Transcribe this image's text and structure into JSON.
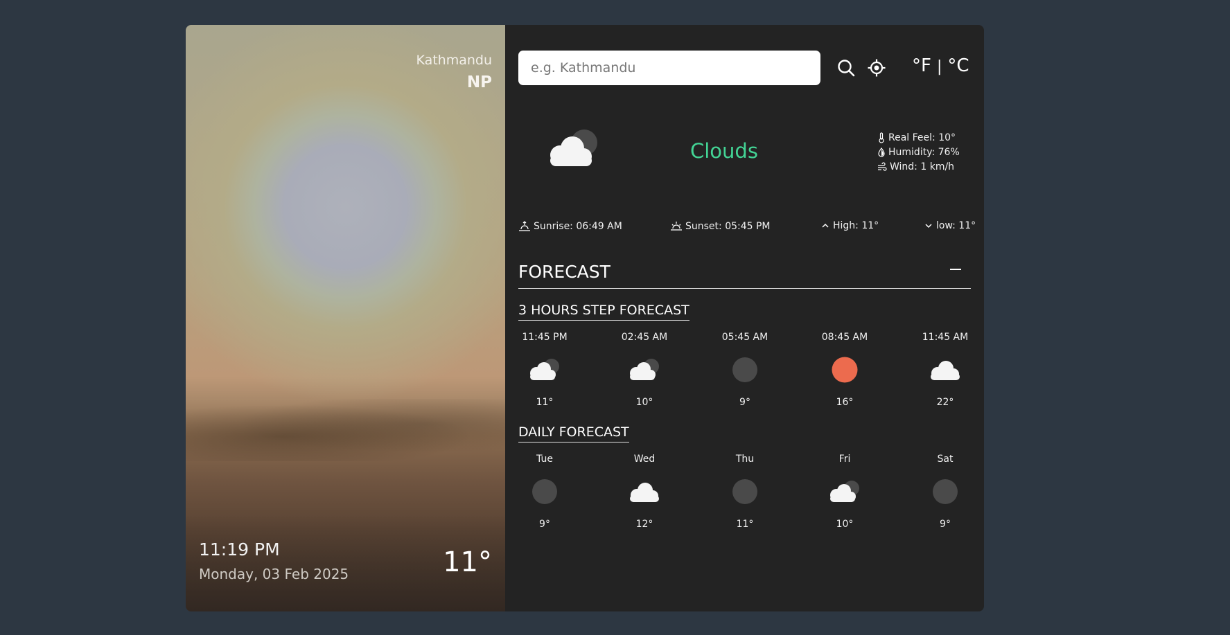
{
  "location": {
    "city": "Kathmandu",
    "country": "NP"
  },
  "left": {
    "time": "11:19 PM",
    "date": "Monday, 03 Feb 2025",
    "temperature": "11°"
  },
  "search": {
    "placeholder": "e.g. Kathmandu",
    "value": ""
  },
  "units": {
    "f": "°F",
    "separator": "|",
    "c": "°C"
  },
  "current": {
    "icon": "cloud-icon",
    "condition": "Clouds",
    "condition_color": "#43d495",
    "real_feel": "Real Feel:  10°",
    "humidity": "Humidity:  76%",
    "wind": "Wind:  1 km/h"
  },
  "sun": {
    "sunrise": "Sunrise: 06:49 AM",
    "sunset": "Sunset: 05:45 PM",
    "high": "High: 11°",
    "low": "low: 11°"
  },
  "forecast": {
    "title": "FORECAST",
    "hourly_title": "3 HOURS STEP FORECAST",
    "hourly": [
      {
        "label": "11:45 PM",
        "icon": "cloud-moon-icon",
        "temp": "11°"
      },
      {
        "label": "02:45 AM",
        "icon": "cloud-moon-icon",
        "temp": "10°"
      },
      {
        "label": "05:45 AM",
        "icon": "moon-icon",
        "temp": "9°"
      },
      {
        "label": "08:45 AM",
        "icon": "sun-icon",
        "temp": "16°"
      },
      {
        "label": "11:45 AM",
        "icon": "cloud-icon",
        "temp": "22°"
      }
    ],
    "daily_title": "DAILY FORECAST",
    "daily": [
      {
        "label": "Tue",
        "icon": "moon-icon",
        "temp": "9°"
      },
      {
        "label": "Wed",
        "icon": "cloud-icon",
        "temp": "12°"
      },
      {
        "label": "Thu",
        "icon": "moon-icon",
        "temp": "11°"
      },
      {
        "label": "Fri",
        "icon": "cloud-moon-icon",
        "temp": "10°"
      },
      {
        "label": "Sat",
        "icon": "moon-icon",
        "temp": "9°"
      }
    ]
  },
  "colors": {
    "background": "#2d3742",
    "panel": "#232323",
    "sun": "#ec6b4e",
    "moon": "#4a4a4a"
  }
}
